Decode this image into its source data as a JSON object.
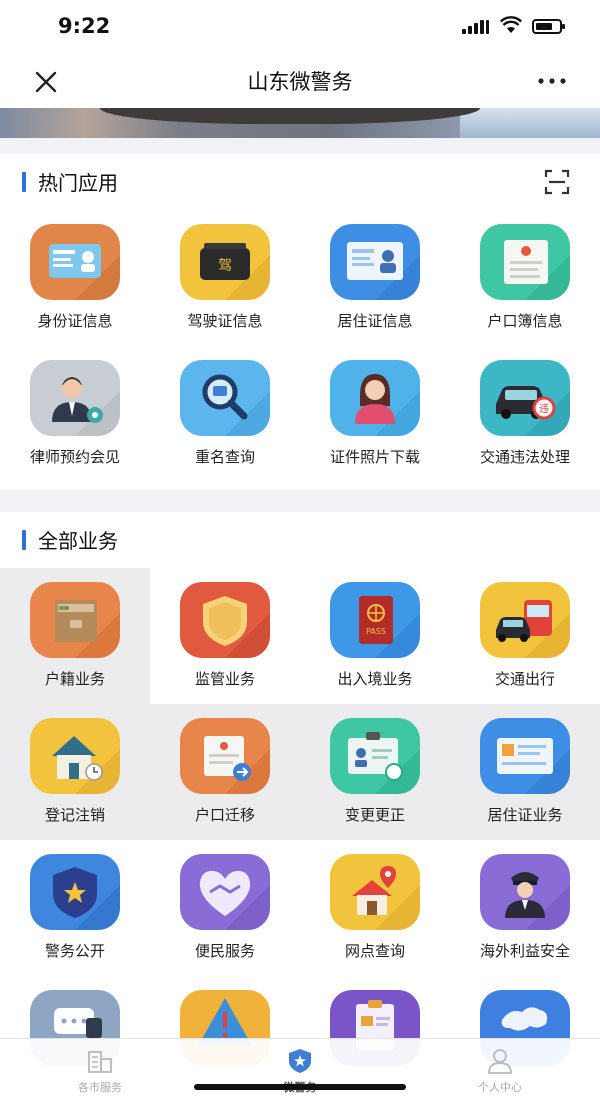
{
  "status_bar": {
    "time": "9:22"
  },
  "nav": {
    "title": "山东微警务"
  },
  "hot_section": {
    "title": "热门应用",
    "apps": [
      {
        "label": "身份证信息",
        "icon": "id-card-icon",
        "color": "#e0864a"
      },
      {
        "label": "驾驶证信息",
        "icon": "driver-license-icon",
        "color": "#f2c33c"
      },
      {
        "label": "居住证信息",
        "icon": "residence-permit-icon",
        "color": "#3e8ee6"
      },
      {
        "label": "户口簿信息",
        "icon": "household-register-icon",
        "color": "#3fc6a2"
      },
      {
        "label": "律师预约会见",
        "icon": "lawyer-icon",
        "color": "#c8ccd3"
      },
      {
        "label": "重名查询",
        "icon": "magnifier-icon",
        "color": "#5cb5ec"
      },
      {
        "label": "证件照片下载",
        "icon": "photo-person-icon",
        "color": "#4fb3ea"
      },
      {
        "label": "交通违法处理",
        "icon": "traffic-violation-car-icon",
        "color": "#3db6c6"
      }
    ]
  },
  "all_section": {
    "title": "全部业务",
    "services": [
      {
        "label": "户籍业务",
        "icon": "household-folder-icon",
        "color": "#e8854a"
      },
      {
        "label": "监管业务",
        "icon": "shield-icon",
        "color": "#e1593f"
      },
      {
        "label": "出入境业务",
        "icon": "passport-icon",
        "color": "#3f97e8"
      },
      {
        "label": "交通出行",
        "icon": "bus-car-icon",
        "color": "#f2c33c"
      },
      {
        "label": "登记注销",
        "icon": "house-clock-icon",
        "color": "#f2c33c"
      },
      {
        "label": "户口迁移",
        "icon": "document-transfer-icon",
        "color": "#e8854a"
      },
      {
        "label": "变更更正",
        "icon": "id-badge-icon",
        "color": "#3fc6a2"
      },
      {
        "label": "居住证业务",
        "icon": "residence-card-icon",
        "color": "#3e8ee6"
      },
      {
        "label": "警务公开",
        "icon": "police-badge-icon",
        "color": "#3e86de"
      },
      {
        "label": "便民服务",
        "icon": "heart-handshake-icon",
        "color": "#8a6cd6"
      },
      {
        "label": "网点查询",
        "icon": "house-pin-icon",
        "color": "#f2c33c"
      },
      {
        "label": "海外利益安全",
        "icon": "officer-icon",
        "color": "#8a6cd6"
      },
      {
        "label": "",
        "icon": "chat-bubble-icon",
        "color": "#8ea6c4"
      },
      {
        "label": "",
        "icon": "warning-icon",
        "color": "#f0b23a"
      },
      {
        "label": "",
        "icon": "form-icon",
        "color": "#7a55c8"
      },
      {
        "label": "",
        "icon": "map-icon",
        "color": "#3e7fe0"
      }
    ]
  },
  "tab_bar": {
    "tabs": [
      {
        "label": "各市服务",
        "icon": "city-building-icon"
      },
      {
        "label": "微警务",
        "icon": "police-shield-icon"
      },
      {
        "label": "个人中心",
        "icon": "person-icon"
      }
    ]
  }
}
